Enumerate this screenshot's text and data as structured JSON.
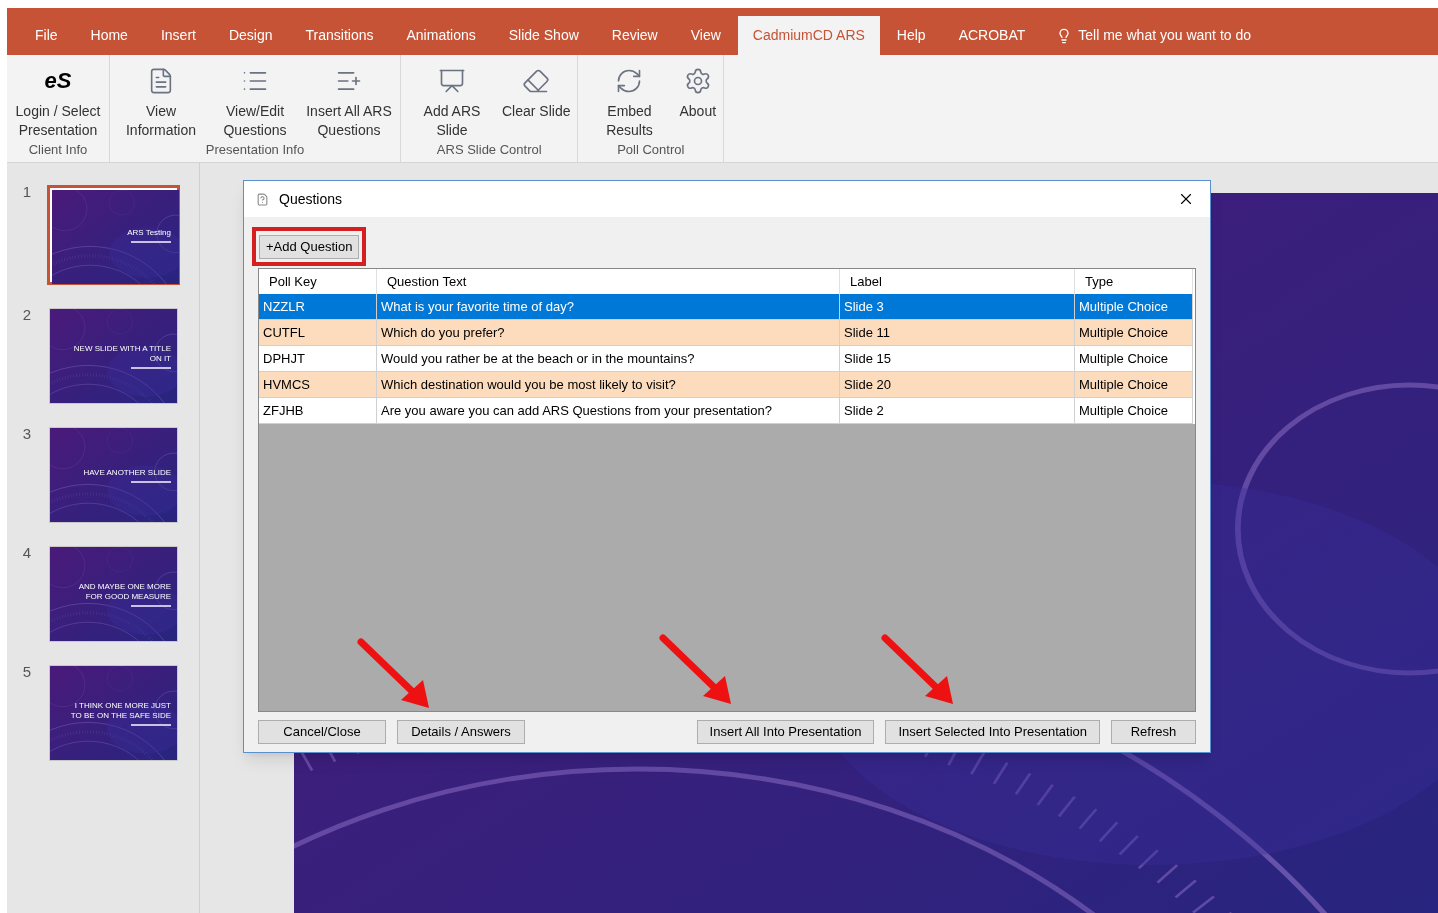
{
  "menu_tabs": [
    {
      "label": "File",
      "selected": false
    },
    {
      "label": "Home",
      "selected": false
    },
    {
      "label": "Insert",
      "selected": false
    },
    {
      "label": "Design",
      "selected": false
    },
    {
      "label": "Transitions",
      "selected": false
    },
    {
      "label": "Animations",
      "selected": false
    },
    {
      "label": "Slide Show",
      "selected": false
    },
    {
      "label": "Review",
      "selected": false
    },
    {
      "label": "View",
      "selected": false
    },
    {
      "label": "CadmiumCD ARS",
      "selected": true
    },
    {
      "label": "Help",
      "selected": false
    },
    {
      "label": "ACROBAT",
      "selected": false
    }
  ],
  "tell_me": "Tell me what you want to do",
  "ribbon_groups": [
    {
      "label": "Client Info",
      "buttons": [
        {
          "kind": "logo",
          "logo": "eS",
          "label": "Login / Select Presentation"
        }
      ]
    },
    {
      "label": "Presentation Info",
      "buttons": [
        {
          "kind": "info",
          "label": "View Information"
        },
        {
          "kind": "edit",
          "label": "View/Edit Questions"
        },
        {
          "kind": "insert",
          "label": "Insert All ARS Questions"
        }
      ]
    },
    {
      "label": "ARS Slide Control",
      "buttons": [
        {
          "kind": "add",
          "label": "Add ARS Slide"
        },
        {
          "kind": "clear",
          "label": "Clear Slide"
        }
      ]
    },
    {
      "label": "Poll Control",
      "buttons": [
        {
          "kind": "embed",
          "label": "Embed Results"
        },
        {
          "kind": "about",
          "label": "About"
        }
      ]
    }
  ],
  "slides": [
    {
      "number": "1",
      "title": "ARS Testing",
      "selected": true
    },
    {
      "number": "2",
      "title": "NEW SLIDE WITH A TITLE ON IT",
      "selected": false
    },
    {
      "number": "3",
      "title": "HAVE ANOTHER SLIDE",
      "selected": false
    },
    {
      "number": "4",
      "title": "AND MAYBE ONE MORE FOR GOOD MEASURE",
      "selected": false
    },
    {
      "number": "5",
      "title": "I THINK ONE MORE JUST TO BE ON THE SAFE SIDE",
      "selected": false
    }
  ],
  "dialog": {
    "title": "Questions",
    "add_button": "+Add Question",
    "columns": [
      "Poll Key",
      "Question Text",
      "Label",
      "Type"
    ],
    "rows": [
      {
        "cells": [
          "NZZLR",
          "What is your favorite time of day?",
          "Slide 3",
          "Multiple Choice"
        ],
        "selected": true
      },
      {
        "cells": [
          "CUTFL",
          "Which do you prefer?",
          "Slide 11",
          "Multiple Choice"
        ],
        "selected": false
      },
      {
        "cells": [
          "DPHJT",
          "Would you rather be at the beach or in the mountains?",
          "Slide 15",
          "Multiple Choice"
        ],
        "selected": false
      },
      {
        "cells": [
          "HVMCS",
          "Which destination would you be most likely to visit?",
          "Slide 20",
          "Multiple Choice"
        ],
        "selected": false
      },
      {
        "cells": [
          "ZFJHB",
          "Are you aware you can add ARS Questions from your presentation?",
          "Slide 2",
          "Multiple Choice"
        ],
        "selected": false
      }
    ],
    "left_buttons": [
      "Cancel/Close",
      "Details / Answers"
    ],
    "right_buttons": [
      "Insert All Into Presentation",
      "Insert Selected Into Presentation",
      "Refresh"
    ]
  }
}
